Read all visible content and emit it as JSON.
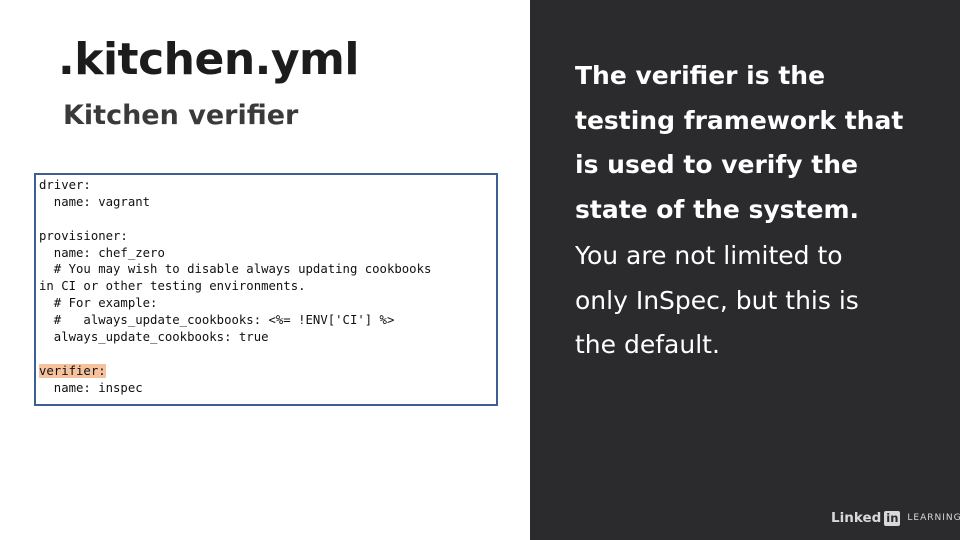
{
  "title": ".kitchen.yml",
  "subtitle": "Kitchen verifier",
  "code": {
    "lines": [
      "driver:",
      "  name: vagrant",
      "",
      "provisioner:",
      "  name: chef_zero",
      "  # You may wish to disable always updating cookbooks",
      "in CI or other testing environments.",
      "  # For example:",
      "  #   always_update_cookbooks: <%= !ENV['CI'] %>",
      "  always_update_cookbooks: true",
      "",
      "verifier:",
      "  name: inspec"
    ],
    "highlighted_line": "verifier:",
    "highlight_color": "#f6c29d"
  },
  "description": {
    "bold_lines": [
      "The verifier is the",
      "testing framework that",
      "is used to verify the",
      "state of the system."
    ],
    "normal_lines": [
      "You are not limited to",
      "only InSpec, but this is",
      "the default."
    ]
  },
  "brand": {
    "linked": "Linked",
    "in": "in",
    "learning": "LEARNING"
  },
  "colors": {
    "right_panel_bg": "#2b2b2e",
    "code_border": "#3d5f91"
  }
}
